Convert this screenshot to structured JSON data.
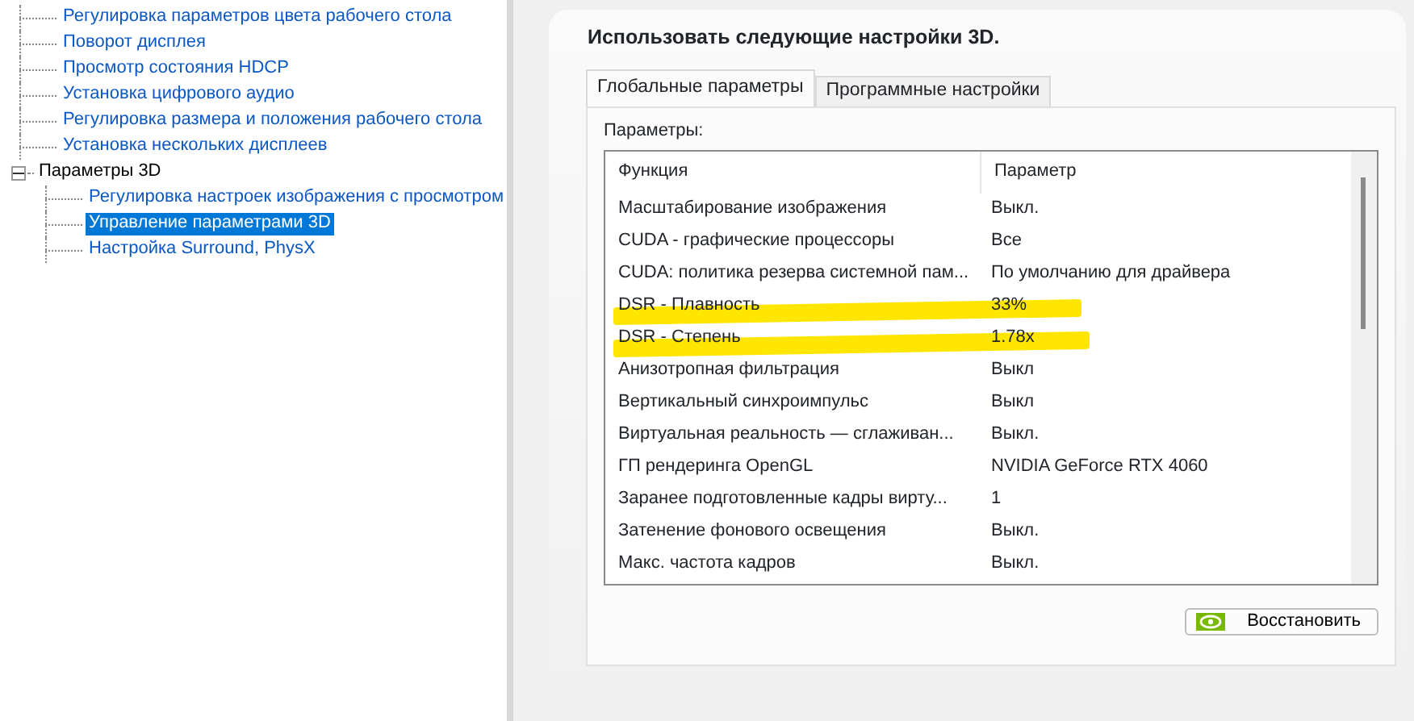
{
  "tree": [
    {
      "label": "Регулировка параметров цвета рабочего стола",
      "selected": false
    },
    {
      "label": "Поворот дисплея",
      "selected": false
    },
    {
      "label": "Просмотр состояния HDCP",
      "selected": false
    },
    {
      "label": "Установка цифрового аудио",
      "selected": false
    },
    {
      "label": "Регулировка размера и положения рабочего стола",
      "selected": false
    },
    {
      "label": "Установка нескольких дисплеев",
      "selected": false
    },
    {
      "label": "Параметры 3D",
      "selected": false,
      "expanded": true,
      "children": [
        {
          "label": "Регулировка настроек изображения с просмотром",
          "selected": false
        },
        {
          "label": "Управление параметрами 3D",
          "selected": true
        },
        {
          "label": "Настройка Surround, PhysX",
          "selected": false
        }
      ]
    }
  ],
  "heading": "Использовать следующие настройки 3D.",
  "tabs": [
    {
      "label": "Глобальные параметры",
      "selected": true
    },
    {
      "label": "Программные настройки",
      "selected": false
    }
  ],
  "params_label": "Параметры:",
  "table": {
    "columns": [
      "Функция",
      "Параметр"
    ],
    "rows": [
      {
        "function": "Масштабирование изображения",
        "value": "Выкл.",
        "highlighted": false
      },
      {
        "function": "CUDA - графические процессоры",
        "value": "Все",
        "highlighted": false
      },
      {
        "function": "CUDA: политика резерва системной пам...",
        "value": "По умолчанию для драйвера",
        "highlighted": false
      },
      {
        "function": "DSR - Плавность",
        "value": "33%",
        "highlighted": true
      },
      {
        "function": "DSR - Степень",
        "value": "1.78x",
        "highlighted": true
      },
      {
        "function": "Анизотропная фильтрация",
        "value": "Выкл",
        "highlighted": false
      },
      {
        "function": "Вертикальный синхроимпульс",
        "value": "Выкл",
        "highlighted": false
      },
      {
        "function": "Виртуальная реальность — сглаживан...",
        "value": "Выкл.",
        "highlighted": false
      },
      {
        "function": "ГП рендеринга OpenGL",
        "value": "NVIDIA GeForce RTX 4060",
        "highlighted": false
      },
      {
        "function": "Заранее подготовленные кадры вирту...",
        "value": "1",
        "highlighted": false
      },
      {
        "function": "Затенение фонового освещения",
        "value": "Выкл.",
        "highlighted": false
      },
      {
        "function": "Макс. частота кадров",
        "value": "Выкл.",
        "highlighted": false
      }
    ]
  },
  "restore_button": "Восстановить"
}
